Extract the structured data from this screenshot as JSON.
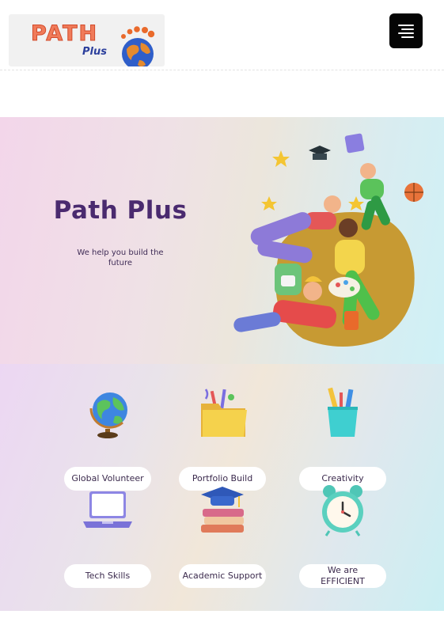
{
  "header": {
    "logo_text": "PATH",
    "logo_sub": "Plus",
    "menu_icon": "hamburger-menu-icon"
  },
  "hero": {
    "title": "Path Plus",
    "subtitle": "We help you build the future"
  },
  "features": [
    {
      "label": "Global Volunteer",
      "icon": "globe-icon"
    },
    {
      "label": "Portfolio Build",
      "icon": "folder-icon"
    },
    {
      "label": "Creativity",
      "icon": "pencil-cup-icon"
    },
    {
      "label": "Tech Skills",
      "icon": "laptop-icon"
    },
    {
      "label": "Academic Support",
      "icon": "books-graduation-icon"
    },
    {
      "label": "We are EFFICIENT",
      "icon": "alarm-clock-icon"
    }
  ],
  "colors": {
    "title": "#4a2a6f",
    "logo_orange": "#f07b5a",
    "logo_blue": "#2b3f9c",
    "menu_bg": "#050505"
  }
}
